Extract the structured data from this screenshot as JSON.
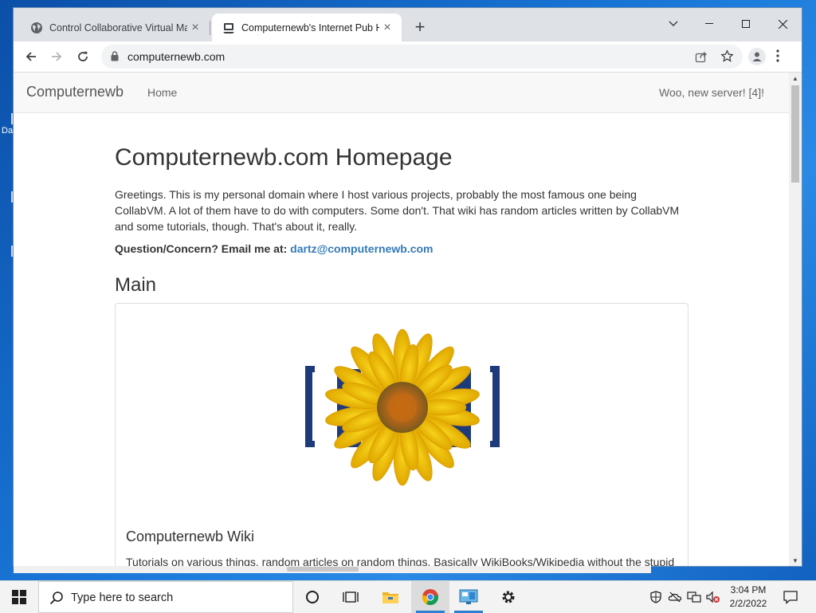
{
  "desktop": {
    "label_fragment": "Da"
  },
  "browser": {
    "tabs": [
      {
        "title": "Control Collaborative Virtual Ma",
        "active": false,
        "icon": "globe-icon"
      },
      {
        "title": "Computernewb's Internet Pub H",
        "active": true,
        "icon": "computernewb-favicon"
      }
    ],
    "new_tab_label": "+",
    "close_glyph": "×",
    "address": {
      "url": "computernewb.com"
    }
  },
  "page": {
    "navbar": {
      "brand": "Computernewb",
      "home": "Home",
      "right_text": "Woo, new server! [4]!"
    },
    "heading": "Computernewb.com Homepage",
    "intro": "Greetings. This is my personal domain where I host various projects, probably the most famous one being CollabVM. A lot of them have to do with computers. Some don't. That wiki has random articles written by CollabVM and some tutorials, though. That's about it, really.",
    "contact_label": "Question/Concern? Email me at:",
    "contact_email": "dartz@computernewb.com",
    "section_title": "Main",
    "card": {
      "logo_icon": "wiki-sunflower-logo",
      "title": "Computernewb Wiki",
      "description": "Tutorials on various things, random articles on random things. Basically WikiBooks/Wikipedia without the stupid"
    }
  },
  "taskbar": {
    "search_placeholder": "Type here to search",
    "clock_time": "3:04 PM",
    "clock_date": "2/2/2022",
    "pinned": [
      "cortana-icon",
      "task-view-icon",
      "file-explorer-icon",
      "chrome-icon",
      "remote-desktop-icon",
      "settings-icon"
    ]
  },
  "colors": {
    "link": "#337ab7",
    "navbar_bg": "#f8f8f8",
    "tabstrip_bg": "#dee1e6",
    "taskbar_bg": "#f3f3f3"
  }
}
